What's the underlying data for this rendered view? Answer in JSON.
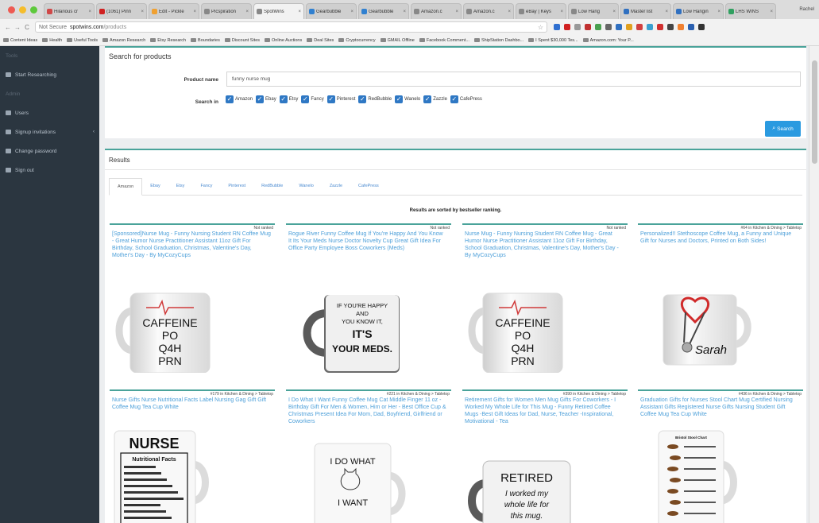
{
  "browser": {
    "tabs": [
      {
        "label": "Hilarious cr",
        "color": "#d04848"
      },
      {
        "label": "(1061) Pinn",
        "color": "#d02020"
      },
      {
        "label": "Edit - Pickle",
        "color": "#f0a030"
      },
      {
        "label": "Picspiration",
        "color": "#888888"
      },
      {
        "label": "SpotWins",
        "color": "#888888",
        "active": true
      },
      {
        "label": "Gearbubble",
        "color": "#3080d0"
      },
      {
        "label": "Gearbubble",
        "color": "#3080d0"
      },
      {
        "label": "Amazon.c",
        "color": "#888888"
      },
      {
        "label": "Amazon.c",
        "color": "#888888"
      },
      {
        "label": "eBay | Keys",
        "color": "#888888"
      },
      {
        "label": "Low Hang",
        "color": "#888888"
      },
      {
        "label": "Master list",
        "color": "#3070c0"
      },
      {
        "label": "Low Hangin",
        "color": "#3070c0"
      },
      {
        "label": "LHS WINS",
        "color": "#30a060"
      }
    ],
    "profile": "Rachel",
    "security": "Not Secure",
    "url_host": "spotwins.com",
    "url_path": "/products",
    "bookmarks": [
      "Content Ideas",
      "Health",
      "Useful Tools",
      "Amazon Research",
      "Etsy Research",
      "Boundaries",
      "Discount Sites",
      "Online Auctions",
      "Deal Sites",
      "Cryptocurrency",
      "GMAIL Offline",
      "Facebook Comment...",
      "ShipStation Dashbo...",
      "I Spent $30,000 Tes...",
      "Amazon.com: Your P..."
    ]
  },
  "sidebar": {
    "items": [
      {
        "label": "Tools",
        "dim": true
      },
      {
        "label": "Start Researching",
        "dim": false
      },
      {
        "label": "Admin",
        "dim": true
      },
      {
        "label": "Users",
        "dim": false
      },
      {
        "label": "Signup invitations",
        "dim": false,
        "chevron": "‹"
      },
      {
        "label": "Change password",
        "dim": false
      },
      {
        "label": "Sign out",
        "dim": false
      }
    ]
  },
  "search": {
    "title": "Search for products",
    "product_name_label": "Product name",
    "product_name_value": "funny nurse mug",
    "search_in_label": "Search in",
    "sites": [
      "Amazon",
      "Ebay",
      "Etsy",
      "Fancy",
      "Pinterest",
      "RedBubble",
      "Wanelo",
      "Zazzle",
      "CafePress"
    ],
    "button_label": "Search",
    "button_icon": "search-icon"
  },
  "results": {
    "title": "Results",
    "tabs": [
      "Amazon",
      "Ebay",
      "Etsy",
      "Fancy",
      "Pinterest",
      "RedBubble",
      "Wanelo",
      "Zazzle",
      "CafePress"
    ],
    "active_tab": "Amazon",
    "sort_note": "Results are sorted by bestseller ranking.",
    "cards": [
      {
        "title": "[Sponsored]Nurse Mug - Funny Nursing Student RN Coffee Mug - Great Humor Nurse Practitioner Assistant 11oz Gift For Birthday, School Graduation, Christmas, Valentine's Day, Mother's Day - By MyCozyCups",
        "rank": "Not ranked",
        "mug_text": [
          "CAFFEINE",
          "PO",
          "Q4H",
          "PRN"
        ]
      },
      {
        "title": "Rogue River Funny Coffee Mug If You're Happy And You Know It Its Your Meds Nurse Doctor Novelty Cup Great Gift Idea For Office Party Employee Boss Coworkers (Meds)",
        "rank": "Not ranked",
        "mug_text": [
          "IF YOU'RE HAPPY",
          "AND",
          "YOU KNOW IT,",
          "IT'S",
          "YOUR MEDS."
        ]
      },
      {
        "title": "Nurse Mug - Funny Nursing Student RN Coffee Mug - Great Humor Nurse Practitioner Assistant 11oz Gift For Birthday, School Graduation, Christmas, Valentine's Day, Mother's Day - By MyCozyCups",
        "rank": "Not ranked",
        "mug_text": [
          "CAFFEINE",
          "PO",
          "Q4H",
          "PRN"
        ]
      },
      {
        "title": "Personalized!! Stethoscope Coffee Mug, a Funny and Unique Gift for Nurses and Doctors, Printed on Both Sides!",
        "rank": "#64 in Kitchen & Dining > Tabletop",
        "mug_text": [
          "Sarah"
        ]
      },
      {
        "title": "Nurse Gifts Nurse Nutritional Facts Label Nursing Gag Gift Gift Coffee Mug Tea Cup White",
        "rank": "#179 in Kitchen & Dining > Tabletop",
        "mug_text": [
          "NURSE",
          "Nutritional Facts"
        ]
      },
      {
        "title": "I Do What I Want Funny Coffee Mug Cat Middle Finger 11 oz - Birthday Gift For Men & Women, Him or Her - Best Office Cup & Christmas Present Idea For Mom, Dad, Boyfriend, Girlfriend or Coworkers",
        "rank": "#221 in Kitchen & Dining > Tabletop",
        "mug_text": [
          "I DO WHAT",
          "I WANT"
        ]
      },
      {
        "title": "Retirement Gifts for Women Men Mug Gifts For Coworkers - I Worked My Whole Life for This Mug - Funny Retired Coffee Mugs -Best Gift Ideas for Dad, Nurse, Teacher -Inspirational, Motivational - Tea",
        "rank": "#390 in Kitchen & Dining > Tabletop",
        "mug_text": [
          "RETIRED",
          "I worked my",
          "whole life for",
          "this mug."
        ]
      },
      {
        "title": "Graduation Gifts for Nurses Stool Chart Mug Certified Nursing Assistant Gifts Registered Nurse Gifts Nursing Student Gift Coffee Mug Tea Cup White",
        "rank": "#436 in Kitchen & Dining > Tabletop",
        "mug_text": [
          "Bristol Stool Chart"
        ]
      }
    ]
  }
}
